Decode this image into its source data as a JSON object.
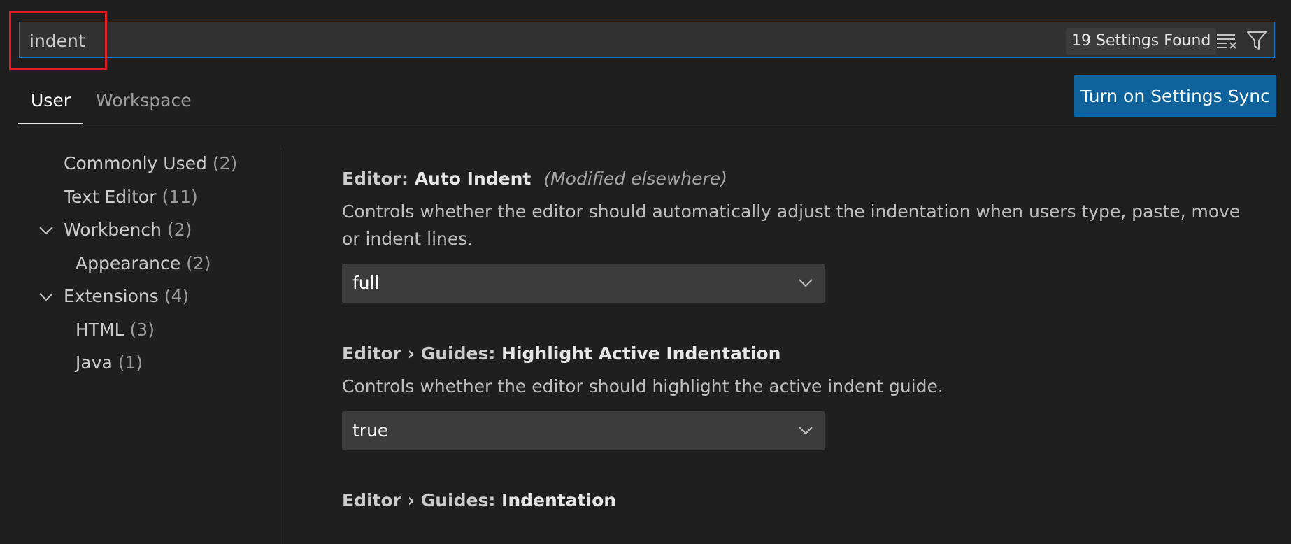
{
  "search": {
    "value": "indent",
    "results_badge": "19 Settings Found"
  },
  "icons": {
    "clear_filter": "clear-filter-icon",
    "filter": "filter-icon",
    "chevron": "chevron-down-icon"
  },
  "tabs": [
    {
      "label": "User",
      "active": true
    },
    {
      "label": "Workspace",
      "active": false
    }
  ],
  "sync_button": {
    "label": "Turn on Settings Sync"
  },
  "tree": [
    {
      "label": "Commonly Used",
      "count": "(2)",
      "expanded": null
    },
    {
      "label": "Text Editor",
      "count": "(11)",
      "expanded": null
    },
    {
      "label": "Workbench",
      "count": "(2)",
      "expanded": true
    },
    {
      "label": "Appearance",
      "count": "(2)",
      "expanded": null
    },
    {
      "label": "Extensions",
      "count": "(4)",
      "expanded": true
    },
    {
      "label": "HTML",
      "count": "(3)",
      "expanded": null
    },
    {
      "label": "Java",
      "count": "(1)",
      "expanded": null
    }
  ],
  "settings": [
    {
      "category": "Editor: ",
      "name": "Auto Indent",
      "modified": "(Modified elsewhere)",
      "description": "Controls whether the editor should automatically adjust the indentation when users type, paste, move or indent lines.",
      "value": "full"
    },
    {
      "category": "Editor › Guides: ",
      "name": "Highlight Active Indentation",
      "modified": "",
      "description": "Controls whether the editor should highlight the active indent guide.",
      "value": "true"
    },
    {
      "category": "Editor › Guides: ",
      "name": "Indentation",
      "modified": "",
      "description": "",
      "value": ""
    }
  ],
  "colors": {
    "accent": "#0078d4",
    "button": "#0e639c",
    "highlight_box": "#e01b24",
    "background": "#1f1f1f"
  }
}
